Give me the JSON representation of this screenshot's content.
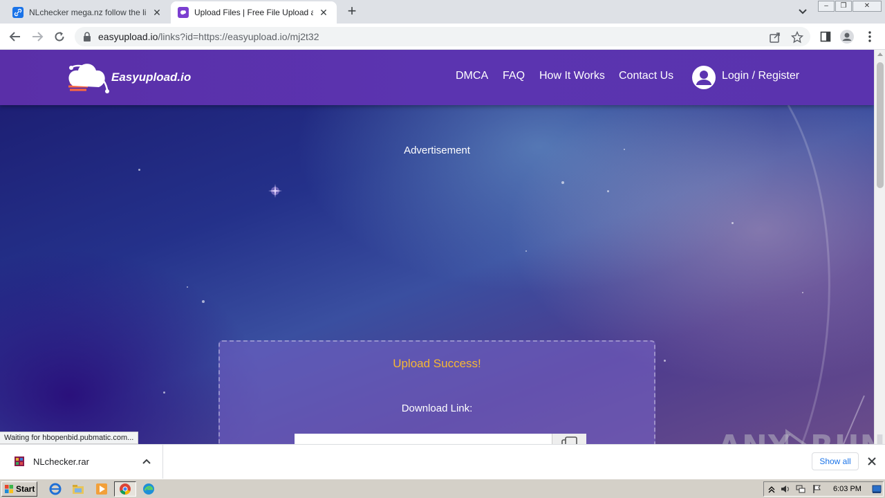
{
  "browser": {
    "tabs": [
      {
        "title": "NLchecker mega.nz follow the link —",
        "active": false
      },
      {
        "title": "Upload Files | Free File Upload and T",
        "active": true
      }
    ],
    "url": {
      "domain": "easyupload.io",
      "path": "/links?id=https://easyupload.io/mj2t32"
    },
    "status_text": "Waiting for hbopenbid.pubmatic.com..."
  },
  "site": {
    "logo_text": "Easyupload.io",
    "nav": {
      "dmca": "DMCA",
      "faq": "FAQ",
      "how": "How It Works",
      "contact": "Contact Us",
      "login": "Login / Register"
    },
    "advertisement": "Advertisement",
    "upload": {
      "title": "Upload Success!",
      "download_label": "Download Link:"
    },
    "colors": {
      "header": "#5b34b0",
      "success": "#f7b733"
    }
  },
  "downloads": {
    "items": [
      {
        "name": "NLchecker.rar"
      }
    ],
    "show_all": "Show all"
  },
  "watermark": "ANY RUN",
  "taskbar": {
    "start_label": "Start",
    "clock": "6:03 PM"
  }
}
